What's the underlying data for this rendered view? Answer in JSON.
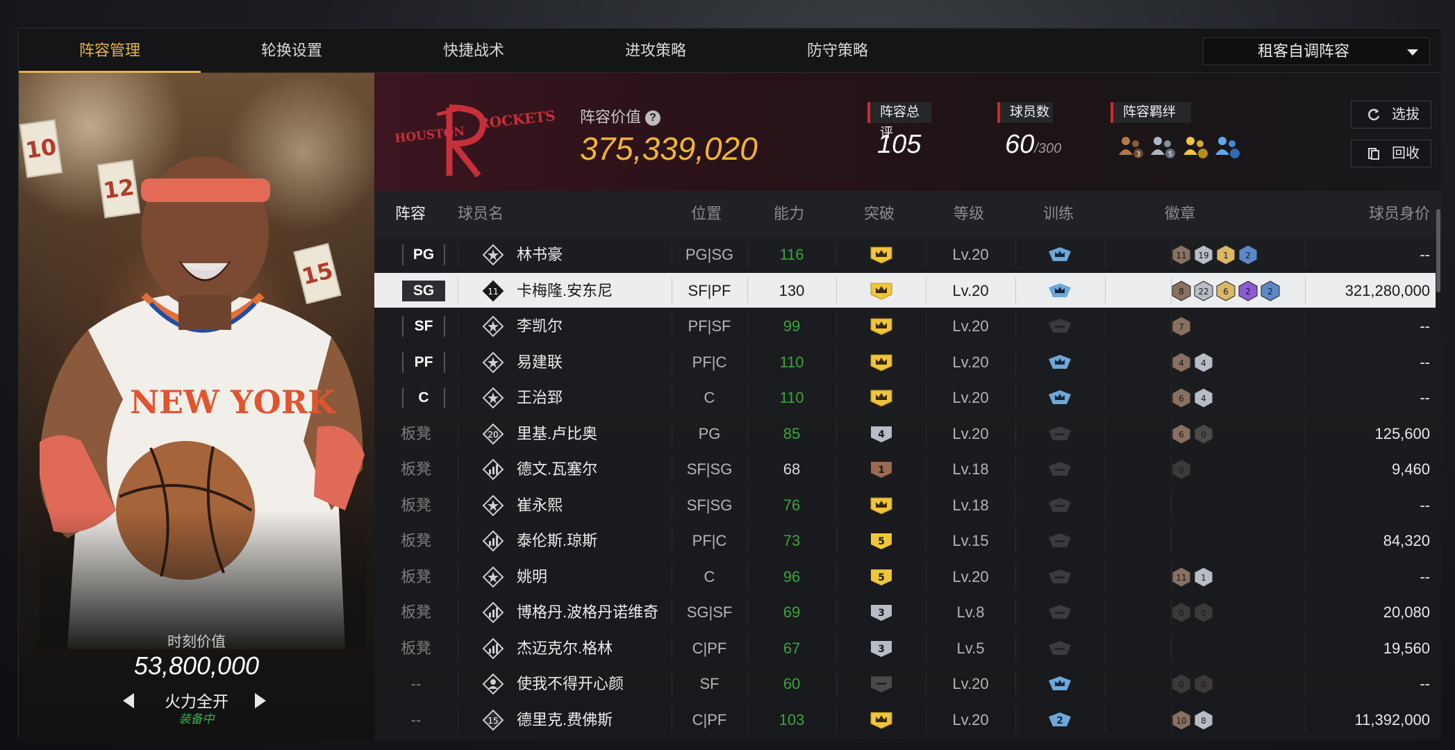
{
  "nav": {
    "tabs": [
      "阵容管理",
      "轮换设置",
      "快捷战术",
      "进攻策略",
      "防守策略"
    ],
    "active_tab": 0,
    "lineup_select": "租客自调阵容"
  },
  "card": {
    "moment_label": "时刻价值",
    "moment_value": "53,800,000",
    "mode_name": "火力全开",
    "mode_state": "装备中",
    "jersey_signs": [
      "10",
      "12",
      "15"
    ],
    "jersey_text": "NEW YORK"
  },
  "summary": {
    "team_logo_text": [
      "HOUSTON",
      "ROCKETS"
    ],
    "value_label": "阵容价值",
    "value": "375,339,020",
    "rating_label": "阵容总评",
    "rating": "105",
    "players_label": "球员数",
    "players": "60",
    "players_max": "/300",
    "synergy_label": "阵容羁绊",
    "synergy_counts": [
      "3",
      "5",
      "",
      ""
    ],
    "select_btn": "选拔",
    "recycle_btn": "回收"
  },
  "table": {
    "headers": [
      "阵容",
      "球员名",
      "位置",
      "能力",
      "突破",
      "等级",
      "训练",
      "徽章",
      "球员身价"
    ],
    "rows": [
      {
        "slot": "PG",
        "icon": "star-icon",
        "name": "林书豪",
        "pos": "PG|SG",
        "ability": "116",
        "breakthrough": "crown",
        "level": "Lv.20",
        "train": "blue",
        "badges": [
          [
            "11",
            "#8a7060"
          ],
          [
            "19",
            "#b8bcc6"
          ],
          [
            "1",
            "#d9b766"
          ],
          [
            "2",
            "#5b88c8"
          ]
        ],
        "price": "--",
        "green": true
      },
      {
        "slot": "SG",
        "icon": "number-11-icon",
        "name": "卡梅隆.安东尼",
        "pos": "SF|PF",
        "ability": "130",
        "breakthrough": "crown",
        "level": "Lv.20",
        "train": "blue",
        "badges": [
          [
            "8",
            "#8a7060"
          ],
          [
            "22",
            "#b8bcc6"
          ],
          [
            "6",
            "#d9b766"
          ],
          [
            "2",
            "#8e5bd6"
          ],
          [
            "2",
            "#5b88c8"
          ]
        ],
        "price": "321,280,000",
        "selected": true
      },
      {
        "slot": "SF",
        "icon": "star-icon",
        "name": "李凯尔",
        "pos": "PF|SF",
        "ability": "99",
        "breakthrough": "crown",
        "level": "Lv.20",
        "train": "gray",
        "badges": [
          [
            "7",
            "#8a7060"
          ]
        ],
        "price": "--",
        "green": true
      },
      {
        "slot": "PF",
        "icon": "star-icon",
        "name": "易建联",
        "pos": "PF|C",
        "ability": "110",
        "breakthrough": "crown",
        "level": "Lv.20",
        "train": "blue",
        "badges": [
          [
            "4",
            "#8a7060"
          ],
          [
            "4",
            "#b8bcc6"
          ]
        ],
        "price": "--",
        "green": true
      },
      {
        "slot": "C",
        "icon": "star-icon",
        "name": "王治郅",
        "pos": "C",
        "ability": "110",
        "breakthrough": "crown",
        "level": "Lv.20",
        "train": "blue",
        "badges": [
          [
            "6",
            "#8a7060"
          ],
          [
            "4",
            "#b8bcc6"
          ]
        ],
        "price": "--",
        "green": true
      },
      {
        "slot": "板凳",
        "icon": "number-20-icon",
        "name": "里基.卢比奥",
        "pos": "PG",
        "ability": "85",
        "breakthrough": "4",
        "level": "Lv.20",
        "train": "gray",
        "badges": [
          [
            "6",
            "#8a7060"
          ],
          [
            "0",
            "#4a4a4a"
          ]
        ],
        "price": "125,600",
        "green": true
      },
      {
        "slot": "板凳",
        "icon": "bars-icon",
        "name": "德文.瓦塞尔",
        "pos": "SF|SG",
        "ability": "68",
        "breakthrough": "1",
        "level": "Lv.18",
        "train": "gray",
        "badges": [
          [
            "0",
            "#3c3a38"
          ]
        ],
        "price": "9,460"
      },
      {
        "slot": "板凳",
        "icon": "star-icon",
        "name": "崔永熙",
        "pos": "SF|SG",
        "ability": "76",
        "breakthrough": "crown",
        "level": "Lv.18",
        "train": "gray",
        "badges": [],
        "price": "--",
        "green": true
      },
      {
        "slot": "板凳",
        "icon": "bars-icon",
        "name": "泰伦斯.琼斯",
        "pos": "PF|C",
        "ability": "73",
        "breakthrough": "5",
        "level": "Lv.15",
        "train": "gray",
        "badges": [],
        "price": "84,320",
        "green": true
      },
      {
        "slot": "板凳",
        "icon": "star-icon",
        "name": "姚明",
        "pos": "C",
        "ability": "96",
        "breakthrough": "5",
        "level": "Lv.20",
        "train": "gray",
        "badges": [
          [
            "11",
            "#8a7060"
          ],
          [
            "1",
            "#b8bcc6"
          ]
        ],
        "price": "--",
        "green": true
      },
      {
        "slot": "板凳",
        "icon": "bars-icon",
        "name": "博格丹.波格丹诺维奇",
        "pos": "SG|SF",
        "ability": "69",
        "breakthrough": "3",
        "level": "Lv.8",
        "train": "gray",
        "badges": [
          [
            "0",
            "#3c3a38"
          ],
          [
            "0",
            "#3c3a38"
          ]
        ],
        "price": "20,080",
        "green": true
      },
      {
        "slot": "板凳",
        "icon": "bars-icon",
        "name": "杰迈克尔.格林",
        "pos": "C|PF",
        "ability": "67",
        "breakthrough": "3",
        "level": "Lv.5",
        "train": "gray",
        "badges": [],
        "price": "19,560",
        "green": true
      },
      {
        "slot": "--",
        "icon": "person-icon",
        "name": "使我不得开心颜",
        "pos": "SF",
        "ability": "60",
        "breakthrough": "dash",
        "level": "Lv.20",
        "train": "blue",
        "badges": [
          [
            "0",
            "#3c3a38"
          ],
          [
            "0",
            "#3c3a38"
          ]
        ],
        "price": "--",
        "green": true
      },
      {
        "slot": "--",
        "icon": "number-15-icon",
        "name": "德里克.费佛斯",
        "pos": "C|PF",
        "ability": "103",
        "breakthrough": "crown",
        "level": "Lv.20",
        "train": "blue2",
        "badges": [
          [
            "10",
            "#8a7060"
          ],
          [
            "8",
            "#b8bcc6"
          ]
        ],
        "price": "11,392,000",
        "green": true
      }
    ]
  },
  "colors": {
    "accent": "#e7b24a",
    "value": "#f1b532",
    "green": "#3aa53a",
    "crown": "#f0c53a",
    "train_blue": "#6ea8d8"
  }
}
